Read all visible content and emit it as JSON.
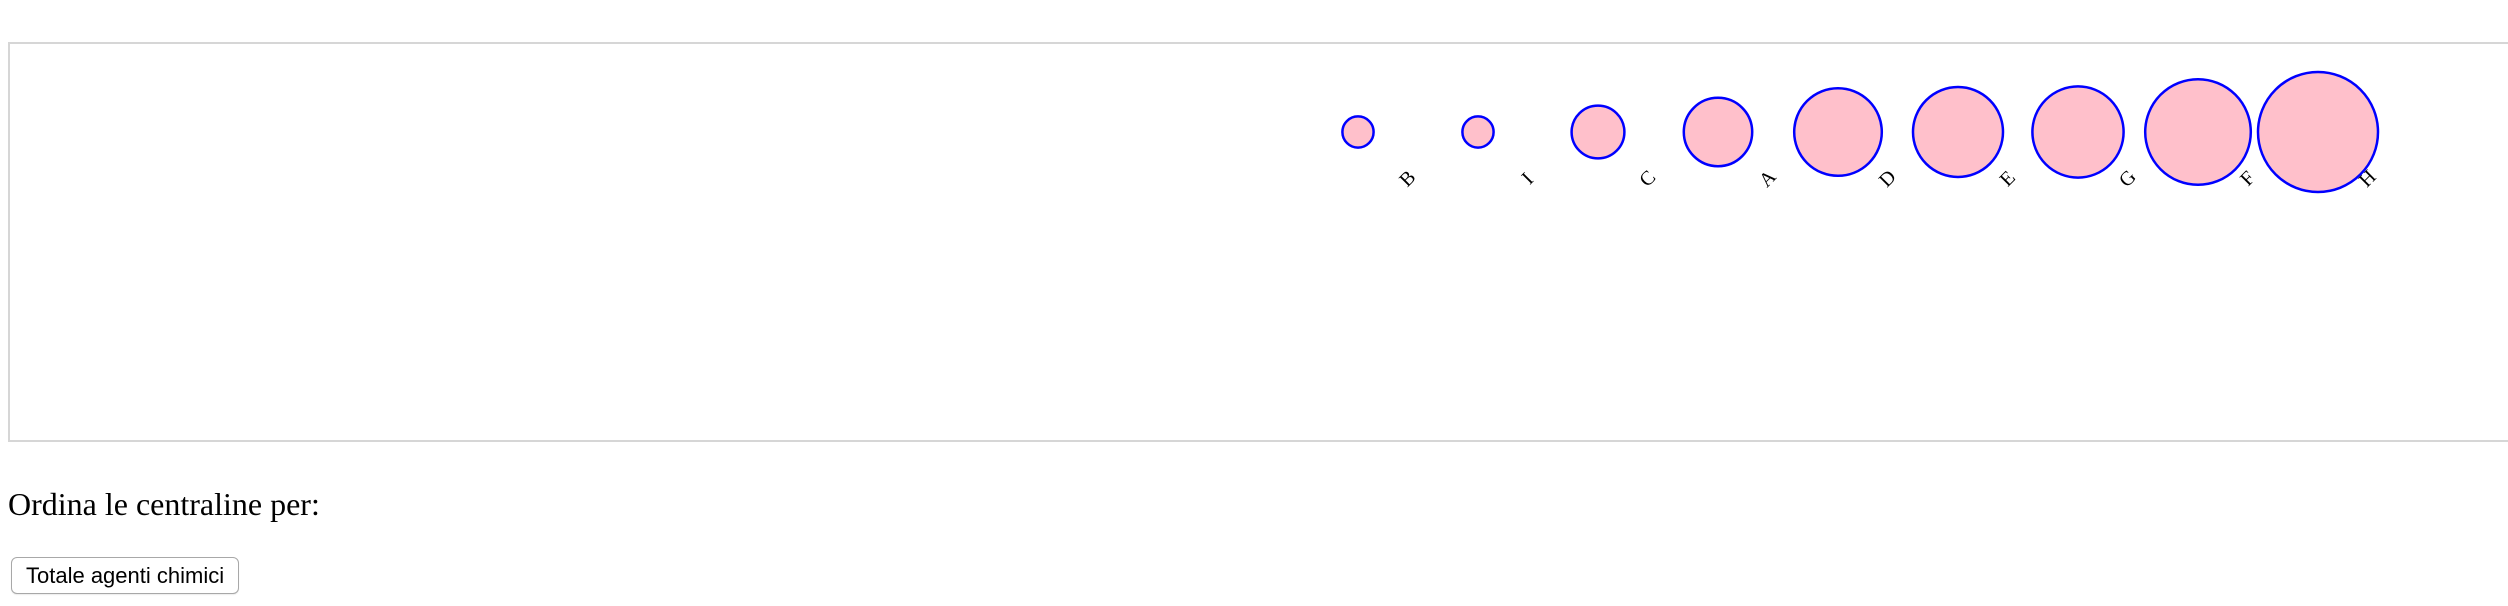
{
  "chart_data": {
    "type": "scatter",
    "title": "",
    "xlabel": "",
    "ylabel": "",
    "grid": false,
    "legend": "none",
    "categories": [
      "B",
      "I",
      "C",
      "A",
      "D",
      "E",
      "G",
      "F",
      "H"
    ],
    "values": [
      0.26,
      0.26,
      0.44,
      0.57,
      0.73,
      0.75,
      0.76,
      0.88,
      1.0
    ],
    "colors": {
      "fill": "#ffc0cb",
      "stroke": "#0000ff",
      "frame": "#d6d6d6"
    }
  },
  "controls": {
    "sort_label": "Ordina le centraline per:",
    "sort_button": "Totale agenti chimici"
  }
}
